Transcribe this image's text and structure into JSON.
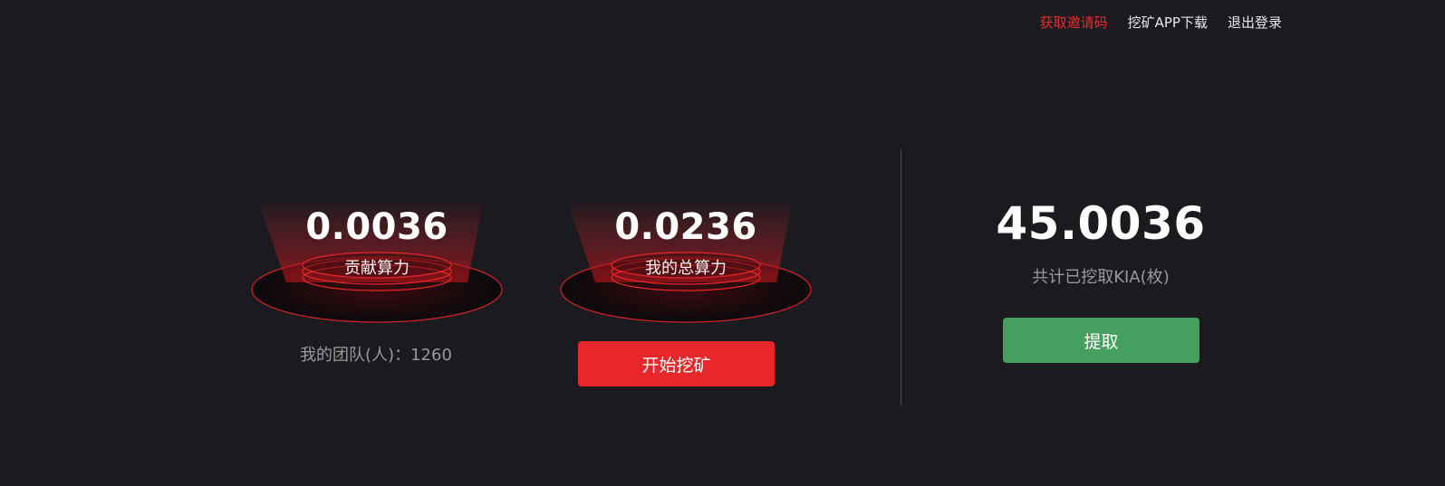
{
  "nav": {
    "items": [
      "获取邀请码",
      "挖矿APP下载",
      "退出登录"
    ],
    "active_index": 0
  },
  "stats": {
    "contribution": {
      "value": "0.0036",
      "label": "贡献算力"
    },
    "my_total": {
      "value": "0.0236",
      "label": "我的总算力"
    }
  },
  "team": {
    "label": "我的团队(人)",
    "separator": "：",
    "count": "1260"
  },
  "buttons": {
    "start_mining": "开始挖矿",
    "withdraw": "提取"
  },
  "total": {
    "value": "45.0036",
    "label": "共计已挖取KIA(枚)"
  },
  "colors": {
    "background": "#1a1a1f",
    "accent_red": "#e8272a",
    "accent_green": "#45a05f",
    "nav_active": "#e03030",
    "muted_text": "#9a9a9a"
  }
}
